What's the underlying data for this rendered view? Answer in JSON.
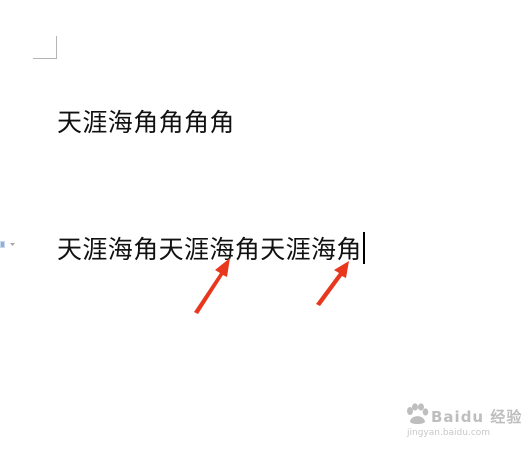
{
  "document": {
    "line1": "天涯海角角角角",
    "line2": "天涯海角天涯海角天涯海角"
  },
  "annotations": {
    "arrow_color": "#e8371c",
    "arrow_count": 2
  },
  "watermark": {
    "logo_text": "Baidu 经验",
    "url": "jingyan.baidu.com"
  },
  "icons": {
    "corner_mark": "margin-corner-icon",
    "anchor": "paragraph-anchor-icon"
  }
}
